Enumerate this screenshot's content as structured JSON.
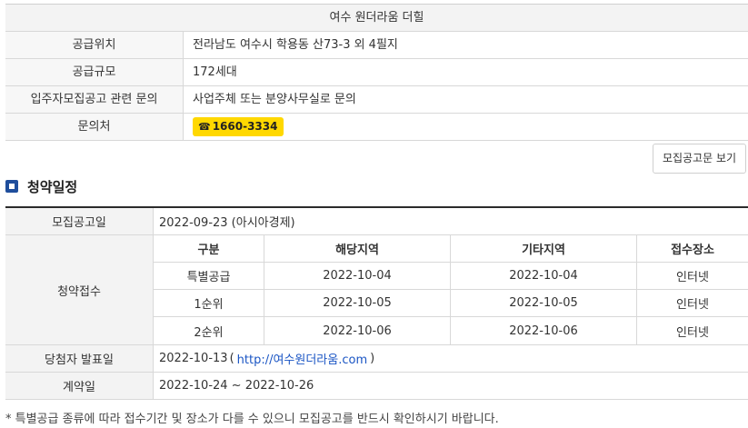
{
  "complex": {
    "title": "여수 원더라움 더힐",
    "rows": [
      {
        "label": "공급위치",
        "value": "전라남도 여수시 학용동 산73-3 외 4필지"
      },
      {
        "label": "공급규모",
        "value": "172세대"
      },
      {
        "label": "입주자모집공고 관련 문의",
        "value": "사업주체 또는 분양사무실로 문의"
      }
    ],
    "contact_label": "문의처",
    "phone_icon": "☎",
    "phone": "1660-3334"
  },
  "notice_button": "모집공고문 보기",
  "section_title": "청약일정",
  "schedule": {
    "announce_label": "모집공고일",
    "announce_value": "2022-09-23 (아시아경제)",
    "apply_label": "청약접수",
    "columns": [
      "구분",
      "해당지역",
      "기타지역",
      "접수장소"
    ],
    "rows": [
      [
        "특별공급",
        "2022-10-04",
        "2022-10-04",
        "인터넷"
      ],
      [
        "1순위",
        "2022-10-05",
        "2022-10-05",
        "인터넷"
      ],
      [
        "2순위",
        "2022-10-06",
        "2022-10-06",
        "인터넷"
      ]
    ],
    "winner_label": "당첨자 발표일",
    "winner_date": "2022-10-13",
    "winner_paren_open": "(",
    "winner_url": "http://여수원더라움.com",
    "winner_paren_close": ")",
    "contract_label": "계약일",
    "contract_value": "2022-10-24 ~ 2022-10-26"
  },
  "footnote": "* 특별공급 종류에 따라 접수기간 및 장소가 다를 수 있으니 모집공고를 반드시 확인하시기 바랍니다.",
  "colors": {
    "accent": "#1f4e9c",
    "phone_chip": "#ffd800",
    "link": "#1a55c4"
  }
}
